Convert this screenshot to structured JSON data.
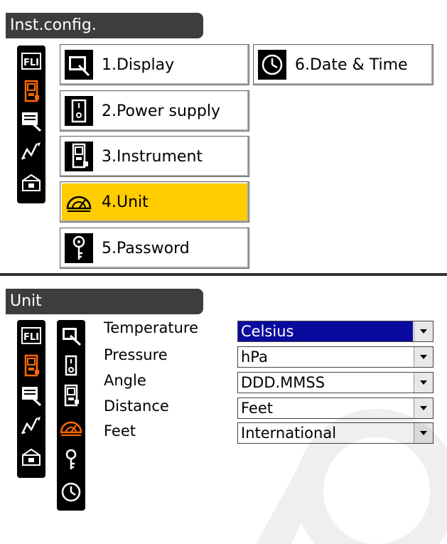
{
  "inst_config": {
    "title": "Inst.config.",
    "menu": [
      {
        "label": "1.Display",
        "icon": "display-icon",
        "selected": false
      },
      {
        "label": "2.Power supply",
        "icon": "power-supply-icon",
        "selected": false
      },
      {
        "label": "3.Instrument",
        "icon": "instrument-icon",
        "selected": false
      },
      {
        "label": "4.Unit",
        "icon": "unit-protractor-icon",
        "selected": true
      },
      {
        "label": "5.Password",
        "icon": "key-icon",
        "selected": false
      },
      {
        "label": "6.Date & Time",
        "icon": "clock-icon",
        "selected": false
      }
    ],
    "sidebar_icons": [
      "tab-fl-icon",
      "instrument-tab-icon",
      "edit-tab-icon",
      "graph-tab-icon",
      "box-tab-icon"
    ]
  },
  "unit": {
    "title": "Unit",
    "fields": [
      {
        "label": "Temperature",
        "value": "Celsius"
      },
      {
        "label": "Pressure",
        "value": "hPa"
      },
      {
        "label": "Angle",
        "value": "DDD.MMSS"
      },
      {
        "label": "Distance",
        "value": "Feet"
      },
      {
        "label": "Feet",
        "value": "International"
      }
    ]
  },
  "colors": {
    "selected": "#ffcc00",
    "focus": "#0a0a9e",
    "titlebar": "#3d3d3d",
    "active_tab_icon": "#ff6a00"
  }
}
